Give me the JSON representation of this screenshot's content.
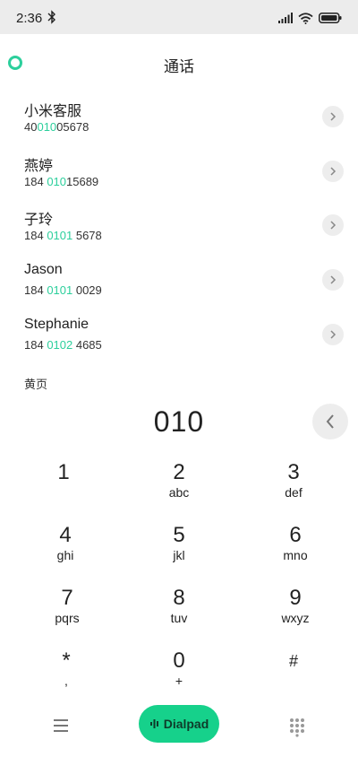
{
  "status_bar": {
    "time": "2:36"
  },
  "header": {
    "title": "通话"
  },
  "contacts": [
    {
      "name": "小米客服",
      "number_pre": "40",
      "number_match": "010",
      "number_post": "05678"
    },
    {
      "name": "燕婷",
      "number_pre": "184 ",
      "number_match": "010",
      "number_post": "15689"
    },
    {
      "name": "子玲",
      "number_pre": "184 ",
      "number_match": "0101",
      "number_post": " 5678"
    },
    {
      "name": "Jason",
      "number_pre": "184 ",
      "number_match": "0101",
      "number_post": " 0029"
    },
    {
      "name": "Stephanie",
      "number_pre": "184 ",
      "number_match": "0102",
      "number_post": " 4685"
    }
  ],
  "section_label": "黄页",
  "dial_input": "010",
  "keys": [
    {
      "digit": "1",
      "letters": ""
    },
    {
      "digit": "2",
      "letters": "abc"
    },
    {
      "digit": "3",
      "letters": "def"
    },
    {
      "digit": "4",
      "letters": "ghi"
    },
    {
      "digit": "5",
      "letters": "jkl"
    },
    {
      "digit": "6",
      "letters": "mno"
    },
    {
      "digit": "7",
      "letters": "pqrs"
    },
    {
      "digit": "8",
      "letters": "tuv"
    },
    {
      "digit": "9",
      "letters": "wxyz"
    },
    {
      "digit": "*",
      "letters": ","
    },
    {
      "digit": "0",
      "letters": "+"
    },
    {
      "digit": "#",
      "letters": ""
    }
  ],
  "bottom_bar": {
    "dialpad_label": "Dialpad"
  },
  "colors": {
    "accent": "#2ccf9c",
    "dialpad_button": "#16d18b"
  }
}
